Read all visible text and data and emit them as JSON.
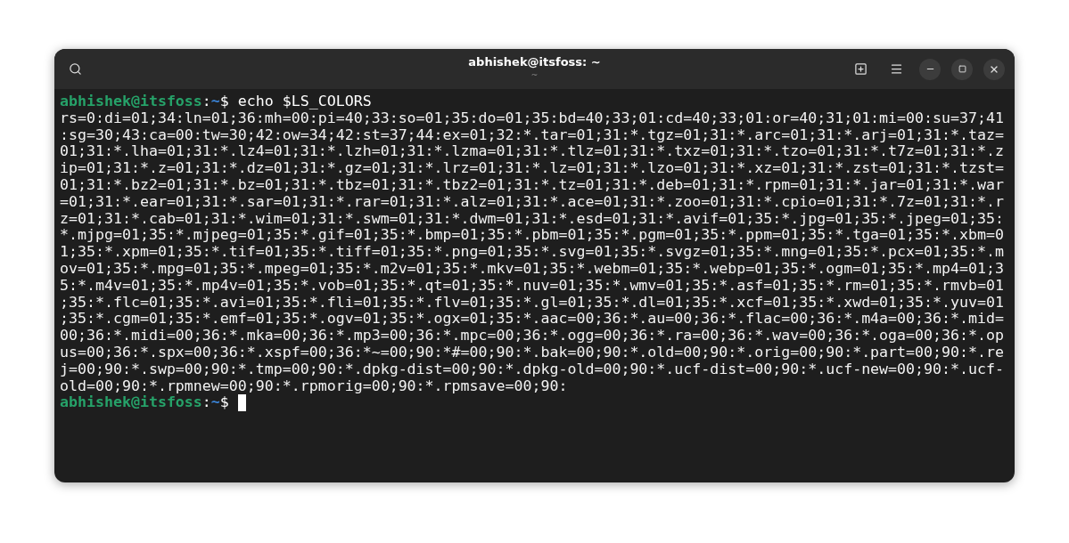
{
  "window": {
    "title": "abhishek@itsfoss: ~",
    "subtitle": "~"
  },
  "terminal": {
    "lines": [
      {
        "kind": "prompt",
        "user_host": "abhishek@itsfoss",
        "separator": ":",
        "path": "~",
        "symbol": "$",
        "command": "echo $LS_COLORS",
        "cursor": false
      },
      {
        "kind": "output",
        "text": "rs=0:di=01;34:ln=01;36:mh=00:pi=40;33:so=01;35:do=01;35:bd=40;33;01:cd=40;33;01:or=40;31;01:mi=00:su=37;41"
      },
      {
        "kind": "output",
        "text": ":sg=30;43:ca=00:tw=30;42:ow=34;42:st=37;44:ex=01;32:*.tar=01;31:*.tgz=01;31:*.arc=01;31:*.arj=01;31:*.taz="
      },
      {
        "kind": "output",
        "text": "01;31:*.lha=01;31:*.lz4=01;31:*.lzh=01;31:*.lzma=01;31:*.tlz=01;31:*.txz=01;31:*.tzo=01;31:*.t7z=01;31:*.z"
      },
      {
        "kind": "output",
        "text": "ip=01;31:*.z=01;31:*.dz=01;31:*.gz=01;31:*.lrz=01;31:*.lz=01;31:*.lzo=01;31:*.xz=01;31:*.zst=01;31:*.tzst="
      },
      {
        "kind": "output",
        "text": "01;31:*.bz2=01;31:*.bz=01;31:*.tbz=01;31:*.tbz2=01;31:*.tz=01;31:*.deb=01;31:*.rpm=01;31:*.jar=01;31:*.war"
      },
      {
        "kind": "output",
        "text": "=01;31:*.ear=01;31:*.sar=01;31:*.rar=01;31:*.alz=01;31:*.ace=01;31:*.zoo=01;31:*.cpio=01;31:*.7z=01;31:*.r"
      },
      {
        "kind": "output",
        "text": "z=01;31:*.cab=01;31:*.wim=01;31:*.swm=01;31:*.dwm=01;31:*.esd=01;31:*.avif=01;35:*.jpg=01;35:*.jpeg=01;35:"
      },
      {
        "kind": "output",
        "text": "*.mjpg=01;35:*.mjpeg=01;35:*.gif=01;35:*.bmp=01;35:*.pbm=01;35:*.pgm=01;35:*.ppm=01;35:*.tga=01;35:*.xbm=0"
      },
      {
        "kind": "output",
        "text": "1;35:*.xpm=01;35:*.tif=01;35:*.tiff=01;35:*.png=01;35:*.svg=01;35:*.svgz=01;35:*.mng=01;35:*.pcx=01;35:*.m"
      },
      {
        "kind": "output",
        "text": "ov=01;35:*.mpg=01;35:*.mpeg=01;35:*.m2v=01;35:*.mkv=01;35:*.webm=01;35:*.webp=01;35:*.ogm=01;35:*.mp4=01;3"
      },
      {
        "kind": "output",
        "text": "5:*.m4v=01;35:*.mp4v=01;35:*.vob=01;35:*.qt=01;35:*.nuv=01;35:*.wmv=01;35:*.asf=01;35:*.rm=01;35:*.rmvb=01"
      },
      {
        "kind": "output",
        "text": ";35:*.flc=01;35:*.avi=01;35:*.fli=01;35:*.flv=01;35:*.gl=01;35:*.dl=01;35:*.xcf=01;35:*.xwd=01;35:*.yuv=01"
      },
      {
        "kind": "output",
        "text": ";35:*.cgm=01;35:*.emf=01;35:*.ogv=01;35:*.ogx=01;35:*.aac=00;36:*.au=00;36:*.flac=00;36:*.m4a=00;36:*.mid="
      },
      {
        "kind": "output",
        "text": "00;36:*.midi=00;36:*.mka=00;36:*.mp3=00;36:*.mpc=00;36:*.ogg=00;36:*.ra=00;36:*.wav=00;36:*.oga=00;36:*.op"
      },
      {
        "kind": "output",
        "text": "us=00;36:*.spx=00;36:*.xspf=00;36:*~=00;90:*#=00;90:*.bak=00;90:*.old=00;90:*.orig=00;90:*.part=00;90:*.re"
      },
      {
        "kind": "output",
        "text": "j=00;90:*.swp=00;90:*.tmp=00;90:*.dpkg-dist=00;90:*.dpkg-old=00;90:*.ucf-dist=00;90:*.ucf-new=00;90:*.ucf-"
      },
      {
        "kind": "output",
        "text": "old=00;90:*.rpmnew=00;90:*.rpmorig=00;90:*.rpmsave=00;90:"
      },
      {
        "kind": "prompt",
        "user_host": "abhishek@itsfoss",
        "separator": ":",
        "path": "~",
        "symbol": "$",
        "cursor": true
      }
    ]
  }
}
